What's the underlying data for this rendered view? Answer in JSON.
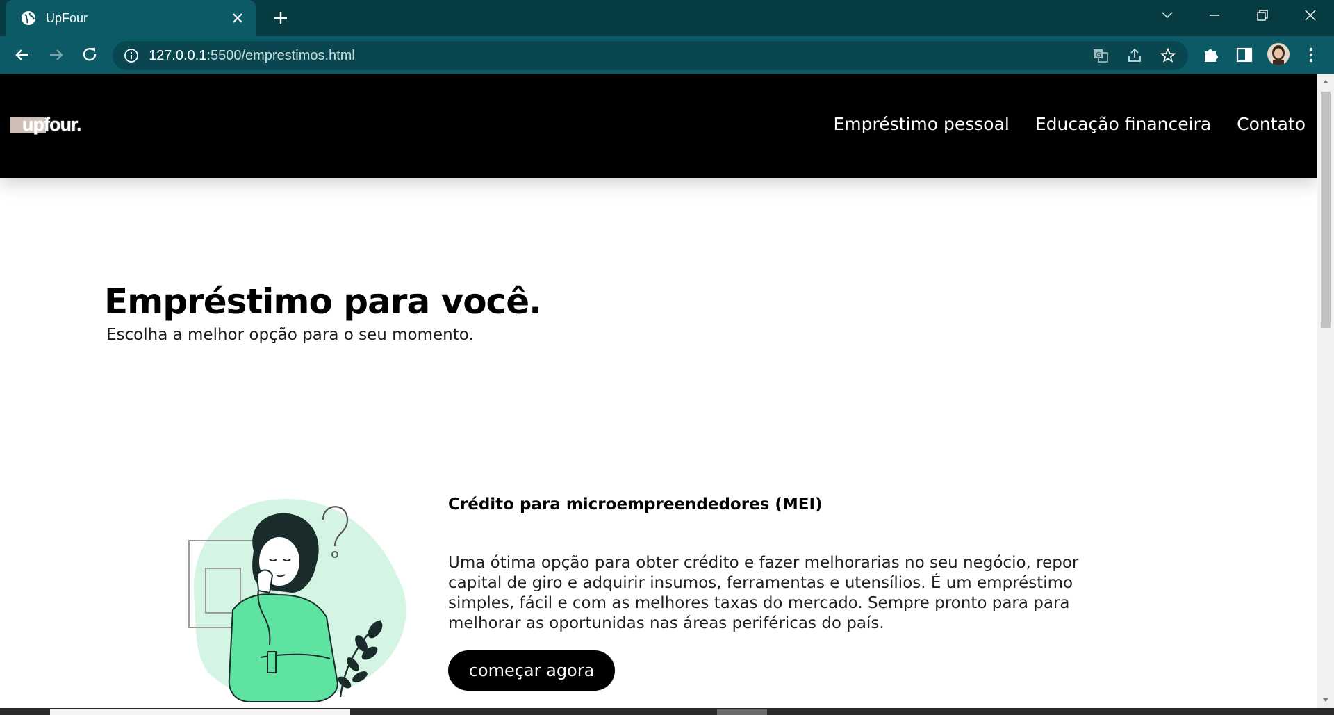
{
  "browser": {
    "tab_title": "UpFour",
    "url_host": "127.0.0.1",
    "url_rest": ":5500/emprestimos.html"
  },
  "site": {
    "logo_text": "upfour.",
    "nav": [
      {
        "label": "Empréstimo pessoal"
      },
      {
        "label": "Educação financeira"
      },
      {
        "label": "Contato"
      }
    ]
  },
  "hero": {
    "title": "Empréstimo para você.",
    "subtitle": "Escolha a melhor opção para o seu momento."
  },
  "card": {
    "title": "Crédito para microempreendedores (MEI)",
    "text": "Uma ótima opção para obter crédito e fazer melhorarias no seu negócio, repor capital de giro e adquirir insumos, ferramentas e utensílios. É um empréstimo simples, fácil e com as melhores taxas do mercado. Sempre pronto para para melhorar as oportunidas nas áreas periféricas do país.",
    "button_label": "começar agora"
  },
  "colors": {
    "chrome_dark": "#073b42",
    "chrome_tab": "#0c5a66",
    "header_bg": "#000000",
    "accent_green": "#5ee3a1",
    "blob_green": "#d4f5e3"
  }
}
